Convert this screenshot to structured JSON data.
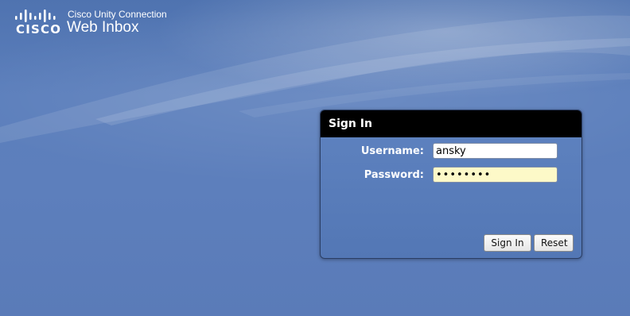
{
  "header": {
    "logo_text": "CISCO",
    "product_name": "Cisco Unity Connection",
    "app_title": "Web Inbox"
  },
  "signin": {
    "title": "Sign In",
    "username_label": "Username:",
    "username_value": "ansky",
    "password_label": "Password:",
    "password_value": "????????",
    "signin_button": "Sign In",
    "reset_button": "Reset"
  },
  "colors": {
    "background": "#5a7dba",
    "panel_header": "#000000",
    "password_field": "#fdf9c8",
    "text_white": "#ffffff"
  },
  "icons": [
    "cisco-logo-icon"
  ]
}
